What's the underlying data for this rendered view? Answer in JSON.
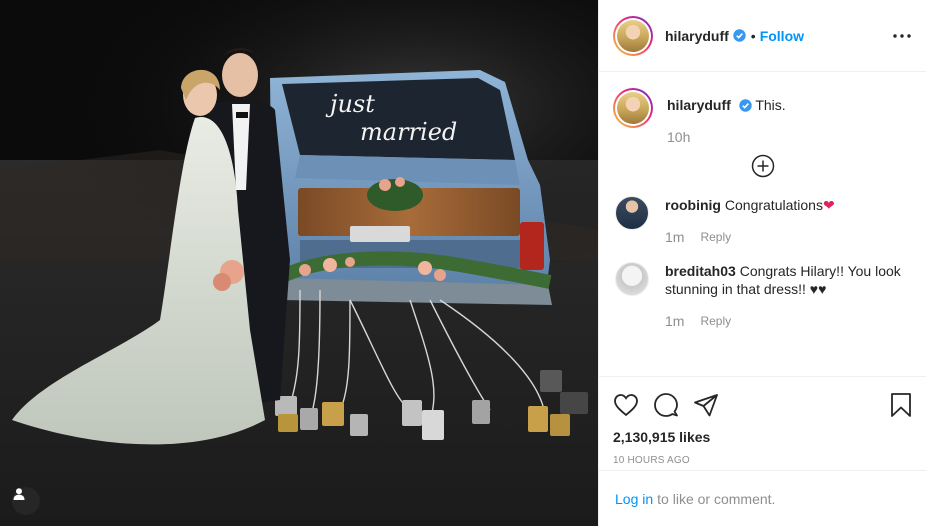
{
  "post": {
    "author": "hilaryduff",
    "verified": true,
    "follow_label": "Follow",
    "separator": "•",
    "caption_text": "This.",
    "caption_time": "10h",
    "photo": {
      "subject": "wedding-couple-with-just-married-car",
      "window_script_line1": "just",
      "window_script_line2": "married"
    }
  },
  "comments": [
    {
      "user": "roobinig",
      "text": "Congratulations",
      "emoji": "❤",
      "time": "1m",
      "reply_label": "Reply"
    },
    {
      "user": "breditah03",
      "text": "Congrats Hilary!! You look stunning in that dress!!",
      "emoji": "♥♥",
      "time": "1m",
      "reply_label": "Reply"
    }
  ],
  "stats": {
    "likes": "2,130,915 likes",
    "posted_ago": "10 HOURS AGO"
  },
  "login": {
    "link_label": "Log in",
    "rest_text": "to like or comment."
  },
  "colors": {
    "accent": "#0095f6",
    "secondary_text": "#8e8e8e",
    "primary_text": "#262626",
    "divider": "#efefef",
    "heart": "#e0245e"
  },
  "icons": {
    "more": "more-options-icon",
    "verified": "verified-badge-icon",
    "load_more": "plus-circle-icon",
    "like": "heart-icon",
    "comment": "comment-icon",
    "share": "share-icon",
    "save": "bookmark-icon",
    "tag": "user-tag-icon"
  }
}
